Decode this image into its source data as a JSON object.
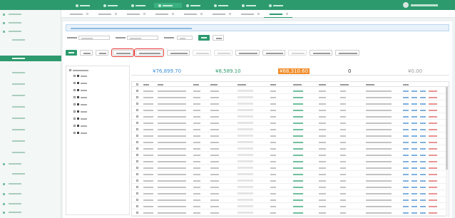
{
  "colors": {
    "brand": "#2d9a6e",
    "highlight": "#e53935",
    "amount_blue": "#3a8fd9",
    "amount_green": "#2d9a6e",
    "amount_orange": "#f28c28",
    "amount_gray": "#999999"
  },
  "app": {
    "logo_text": ""
  },
  "icons": {
    "user": "avatar-icon",
    "folder": "folder-icon",
    "close": "close-icon"
  },
  "stats": {
    "amount_1": "¥76,899.70",
    "amount_2": "¥8,589.10",
    "amount_3": "¥68,310.60",
    "amount_4": "0",
    "amount_5": "¥0.00"
  }
}
